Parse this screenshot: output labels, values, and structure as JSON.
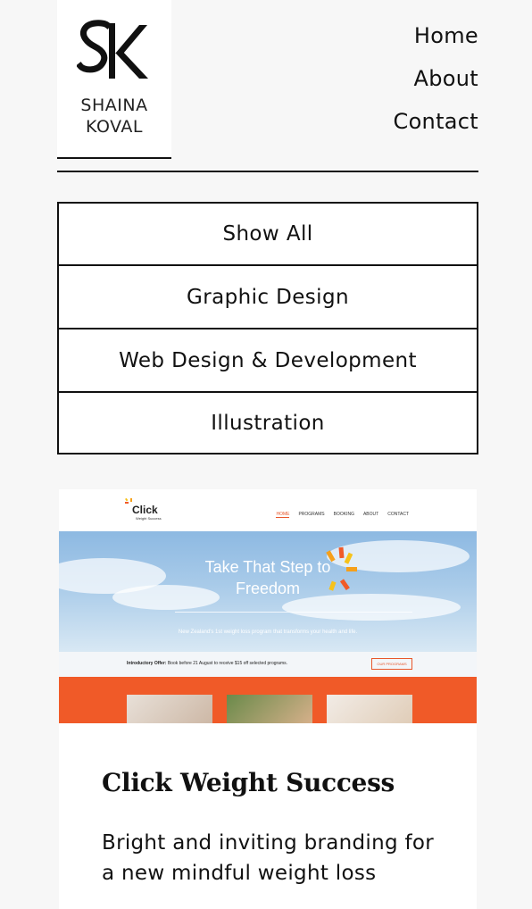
{
  "brand": {
    "line1": "SHAINA",
    "line2": "KOVAL",
    "logo_icon": "sk-monogram-logo"
  },
  "nav": {
    "items": [
      {
        "label": "Home"
      },
      {
        "label": "About"
      },
      {
        "label": "Contact"
      }
    ]
  },
  "filters": [
    {
      "label": "Show All"
    },
    {
      "label": "Graphic Design"
    },
    {
      "label": "Web Design & Development"
    },
    {
      "label": "Illustration"
    }
  ],
  "project": {
    "title": "Click Weight Success",
    "description": "Bright and inviting branding for a new mindful weight loss",
    "thumbnail": {
      "logo_text": "Click",
      "logo_sub": "Weight Success",
      "nav": [
        "HOME",
        "PROGRAMS",
        "BOOKING",
        "ABOUT",
        "CONTACT"
      ],
      "headline_1": "Take That Step to",
      "headline_2": "Freedom",
      "subline": "New Zealand's 1st weight loss program that transforms your health and life.",
      "offer_label": "Introductory Offer:",
      "offer_text": "Book before 21 August to receive $15 off selected programs.",
      "offer_button": "OUR PROGRAMS"
    }
  },
  "colors": {
    "accent_orange": "#f05a28",
    "text": "#111111",
    "background": "#f7f7f7"
  }
}
